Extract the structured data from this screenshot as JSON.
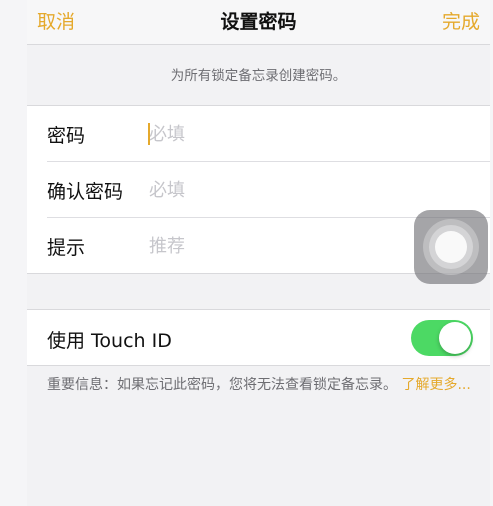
{
  "colors": {
    "accent": "#e5a92c",
    "toggle_on": "#4cd964",
    "background": "#f2f2f4"
  },
  "nav": {
    "cancel": "取消",
    "title": "设置密码",
    "done": "完成"
  },
  "instruction": "为所有锁定备忘录创建密码。",
  "fields": [
    {
      "label": "密码",
      "placeholder": "必填",
      "value": ""
    },
    {
      "label": "确认密码",
      "placeholder": "必填",
      "value": ""
    },
    {
      "label": "提示",
      "placeholder": "推荐",
      "value": ""
    }
  ],
  "touch_id": {
    "label": "使用 Touch ID",
    "enabled": true
  },
  "footnote": {
    "text": "重要信息：如果忘记此密码，您将无法查看锁定备忘录。",
    "link": "了解更多..."
  },
  "assistive_touch": {
    "icon": "assistive-touch-icon"
  }
}
